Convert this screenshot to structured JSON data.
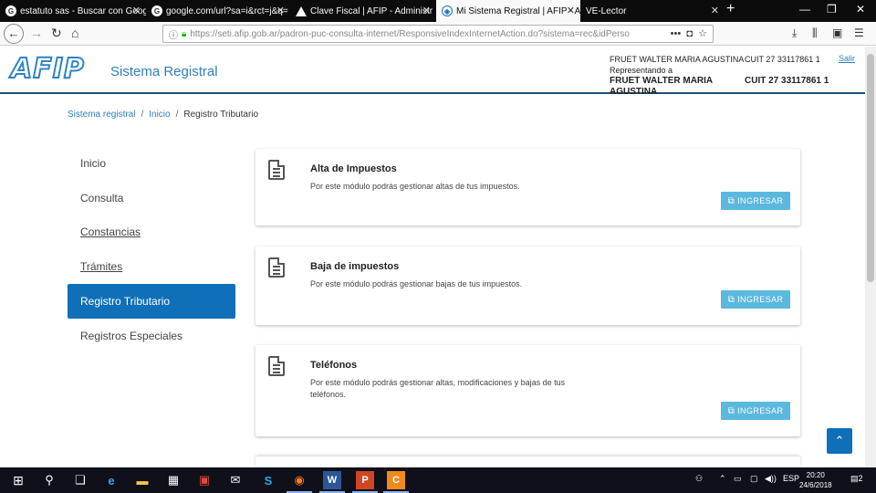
{
  "browser": {
    "tabs": [
      {
        "title": "estatuto sas - Buscar con Google",
        "favicon": "G",
        "active": false
      },
      {
        "title": "google.com/url?sa=i&rct=j&q=",
        "favicon": "G",
        "active": false
      },
      {
        "title": "Clave Fiscal | AFIP - Administr",
        "favicon": "afip",
        "active": false
      },
      {
        "title": "Mi Sistema Registral | AFIP - Ad",
        "favicon": "shield",
        "active": true
      },
      {
        "title": "VE-Lector",
        "favicon": "",
        "active": false
      }
    ],
    "url": "https://seti.afip.gob.ar/padron-puc-consulta-internet/ResponsiveIndexInternetAction.do?sistema=rec&idPersona",
    "url_display": "https://seti.afip.gob.ar/padron-puc-consulta-internet/ResponsiveIndexInternetAction.do?sistema=rec&idPerso",
    "more_icon": "•••"
  },
  "header": {
    "logo_text": "AFIP",
    "brand": "Sistema Registral",
    "user_name": "FRUET WALTER MARIA AGUSTINA",
    "user_cuit": "CUIT 27 33117861 1",
    "represent_label": "Representando a",
    "represent_name": "FRUET WALTER MARIA AGUSTINA",
    "represent_cuit": "CUIT 27 33117861 1",
    "logout": "Salir"
  },
  "breadcrumb": {
    "items": [
      "Sistema registral",
      "Inicio",
      "Registro Tributario"
    ]
  },
  "sidebar": {
    "items": [
      {
        "label": "Inicio"
      },
      {
        "label": "Consulta"
      },
      {
        "label": "Constancias"
      },
      {
        "label": "Trámites"
      },
      {
        "label": "Registro Tributario"
      },
      {
        "label": "Registros Especiales"
      }
    ]
  },
  "cards": [
    {
      "title": "Alta de Impuestos",
      "desc": "Por este módulo podrás gestionar altas de tus impuestos.",
      "button": "INGRESAR"
    },
    {
      "title": "Baja de impuestos",
      "desc": "Por este módulo podrás gestionar bajas de tus impuestos.",
      "button": "INGRESAR"
    },
    {
      "title": "Teléfonos",
      "desc": "Por este módulo podrás gestionar altas, modificaciones y bajas de tus teléfonos.",
      "button": "INGRESAR"
    }
  ],
  "taskbar": {
    "apps": [
      "windows",
      "search",
      "task-view",
      "edge",
      "file-explorer",
      "store",
      "gift",
      "mail",
      "skype",
      "firefox",
      "word",
      "powerpoint",
      "app-orange"
    ],
    "lang": "ESP",
    "time": "20:20",
    "date": "24/6/2018",
    "notification_count": "2"
  },
  "colors": {
    "accent": "#0f6fb8",
    "brand_blue": "#2f7fbf",
    "button": "#5bb8de",
    "header_rule": "#1f5070"
  }
}
